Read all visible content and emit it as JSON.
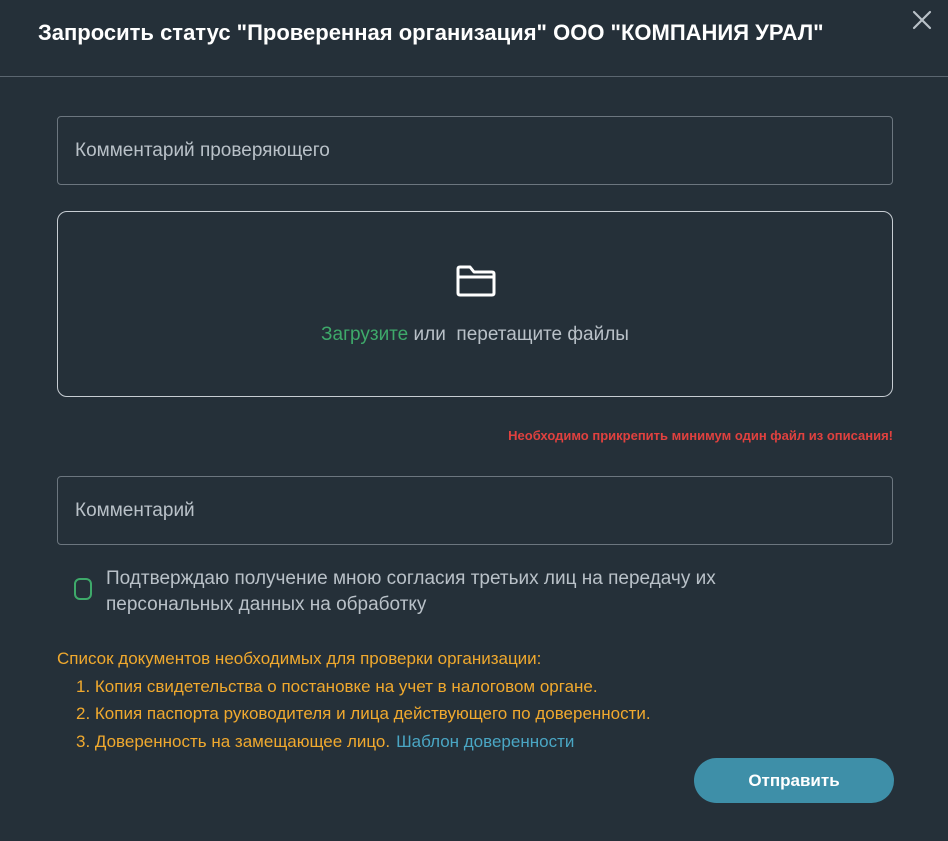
{
  "dialog": {
    "title": "Запросить статус \"Проверенная организация\" ООО \"КОМПАНИЯ УРАЛ\"",
    "close_icon": "close-icon"
  },
  "reviewer_comment": {
    "value": "",
    "placeholder": "Комментарий проверяющего"
  },
  "upload": {
    "icon": "folder-icon",
    "link_text": "Загрузите",
    "rest_text": "или  перетащите файлы"
  },
  "error_message": "Необходимо прикрепить минимум один файл из описания!",
  "comment": {
    "value": "",
    "placeholder": "Комментарий"
  },
  "consent": {
    "checked": false,
    "label": "Подтверждаю получение мною согласия третьих лиц на передачу их персональных данных на обработку"
  },
  "documents": {
    "heading": "Список документов необходимых для проверки организации:",
    "items": [
      "1. Копия свидетельства о постановке на учет в налоговом органе.",
      "2. Копия паспорта руководителя и лица действующего по доверенности.",
      "3. Доверенность на замещающее лицо."
    ],
    "template_link": "Шаблон доверенности"
  },
  "submit_label": "Отправить",
  "colors": {
    "background": "#253039",
    "accent_green": "#3ea96a",
    "error_red": "#e0413f",
    "docs_orange": "#f0a92e",
    "link_blue": "#4aa6c4",
    "button_teal": "#3e8fa8"
  }
}
